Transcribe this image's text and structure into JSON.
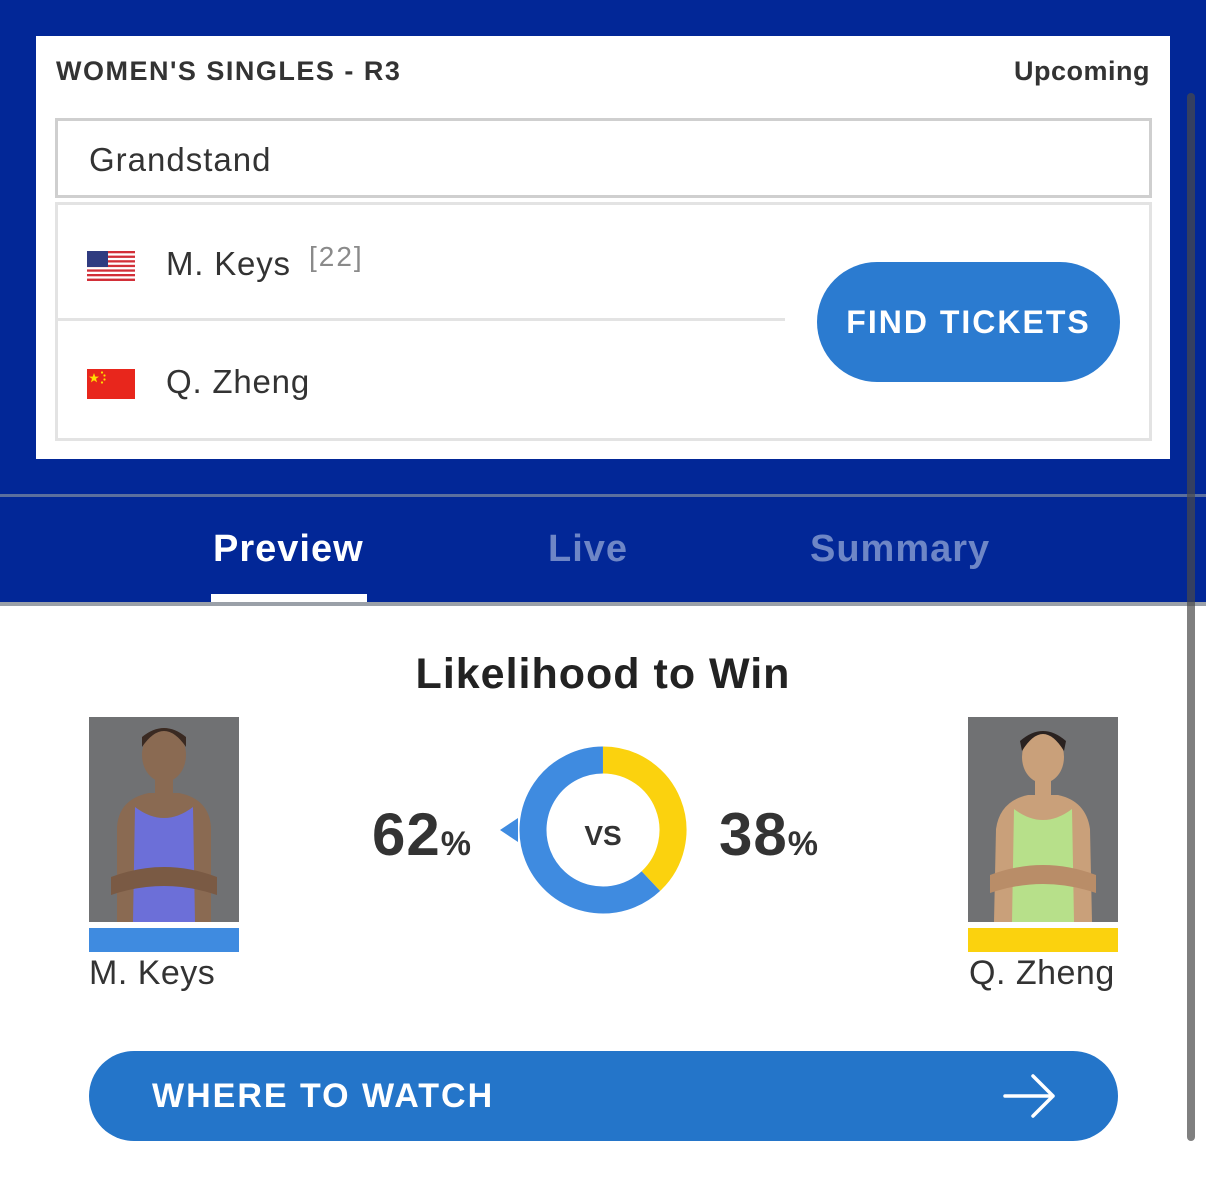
{
  "match": {
    "round": "WOMEN'S SINGLES - R3",
    "status": "Upcoming",
    "court": "Grandstand",
    "find_tickets_label": "FIND TICKETS"
  },
  "players": [
    {
      "name": "M. Keys",
      "seed": "[22]",
      "flag_icon": "usa-flag-icon"
    },
    {
      "name": "Q. Zheng",
      "seed": "",
      "flag_icon": "china-flag-icon"
    }
  ],
  "tabs": [
    {
      "label": "Preview",
      "active": true
    },
    {
      "label": "Live",
      "active": false
    },
    {
      "label": "Summary",
      "active": false
    }
  ],
  "likelihood": {
    "title": "Likelihood to Win",
    "vs_label": "VS",
    "player1": {
      "name": "M. Keys",
      "percent": "62",
      "color": "#3f8be0"
    },
    "player2": {
      "name": "Q. Zheng",
      "percent": "38",
      "color": "#fbd20e"
    },
    "percent_sign": "%"
  },
  "where_to_watch": {
    "label": "WHERE TO WATCH",
    "icon": "arrow-right-icon"
  },
  "colors": {
    "header_bg": "#022797",
    "button_blue": "#2b7bd0",
    "inactive_tab": "#6e86c6"
  }
}
